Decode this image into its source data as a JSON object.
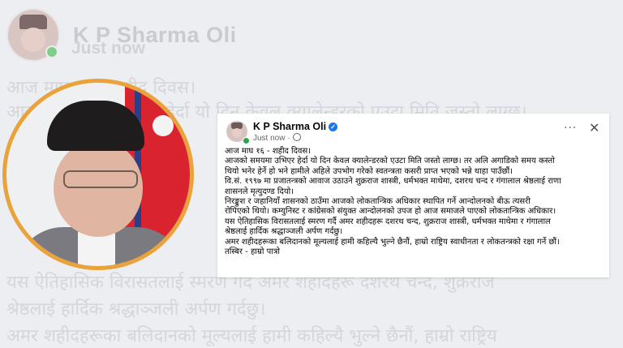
{
  "background": {
    "name": "K P Sharma Oli",
    "time": "Just now",
    "lines": [
      "आज माघ १६ - शहीद दिवस।",
      "आजको समयमा उभिएर हेर्दा यो दिन केवल क्यालेन्डरको एउटा मिति जस्तो लाग्छ।",
      "यस ऐतिहासिक विरासतलाई स्मरण गर्दै अमर शहीदहरू दशरथ चन्द, शुक्रराज",
      "श्रेष्ठलाई हार्दिक श्रद्धाञ्जली अर्पण गर्दछु।",
      "अमर शहीदहरूका बलिदानको मूल्यलाई हामी कहिल्यै भुल्ने छैनौं, हाम्रो राष्ट्रिय"
    ]
  },
  "post": {
    "author": "K P Sharma Oli",
    "verified_icon": "check-badge-icon",
    "time": "Just now",
    "privacy_icon": "globe-icon",
    "more_label": "···",
    "close_label": "✕",
    "body_lines": [
      "आज माघ १६ - शहीद दिवस।",
      "आजको समयमा उभिएर हेर्दा यो दिन केवल क्यालेन्डरको एउटा मिति जस्तो लाग्छ। तर अलि अगाडिको समय कस्तो",
      "थियो भनेर हेर्ने हो भने हामीले अहिले उपभोग गरेको स्वतन्त्रता कसरी प्राप्त भएको भन्ने थाहा पाउँछौं।",
      "वि.सं. १९९७ मा प्रजातन्त्रको आवाज उठाउने शुक्रराज शास्त्री, धर्मभक्त माथेमा, दशरथ चन्द र गंगालाल श्रेष्ठलाई राणा",
      "शासनले मृत्युदण्ड दियो।",
      "निरङ्कुश र जहानियाँ शासनको ठाउँमा आजको लोकतान्त्रिक अधिकार स्थापित गर्ने आन्दोलनको बीऊ त्यसरी",
      "रोपिएको थियो। कम्युनिस्ट र कांग्रेसको संयुक्त आन्दोलनको उपज हो आज समाजले पाएको लोकतान्त्रिक अधिकार।",
      "यस ऐतिहासिक विरासतलाई स्मरण गर्दै अमर शहीदहरू दशरथ चन्द, शुक्रराज शास्त्री, धर्मभक्त माथेमा र गंगालाल",
      "श्रेष्ठलाई हार्दिक श्रद्धाञ्जली अर्पण गर्दछु।",
      "अमर शहीदहरूका बलिदानको मूल्यलाई हामी कहिल्यै भुल्ने छैनौं, हाम्रो राष्ट्रिय स्वाधीनता र लोकतन्त्रको रक्षा गर्ने छौं।",
      "तस्बिर -  हाम्रो पात्रो"
    ]
  }
}
